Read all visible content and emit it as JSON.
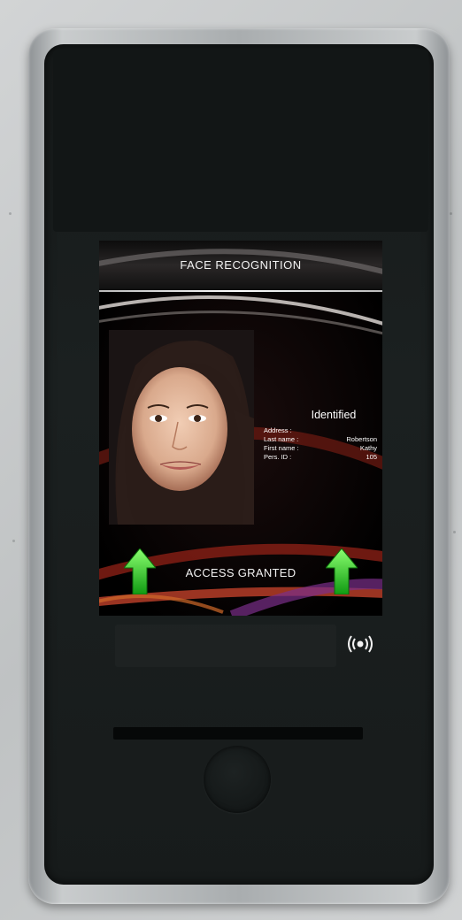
{
  "screen": {
    "title": "FACE RECOGNITION",
    "status": "Identified",
    "fields": [
      {
        "label": "Address",
        "value": ""
      },
      {
        "label": "Last name",
        "value": "Robertson"
      },
      {
        "label": "First name",
        "value": "Kathy"
      },
      {
        "label": "Pers. ID",
        "value": "105"
      }
    ],
    "access_message": "ACCESS GRANTED"
  },
  "icons": {
    "left_arrow": "up-arrow-icon",
    "right_arrow": "up-arrow-icon",
    "rfid": "contactless-icon"
  },
  "colors": {
    "arrow": "#2fd12f",
    "device_face": "#1b2020",
    "frame": "#a9adaf"
  }
}
